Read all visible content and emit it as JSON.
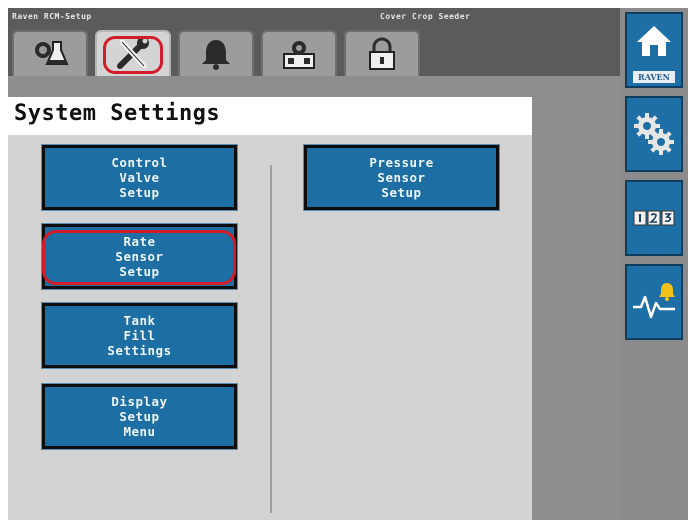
{
  "window": {
    "title_left": "Raven RCM-Setup",
    "title_right": "Cover Crop Seeder"
  },
  "tabs": [
    {
      "icon": "product-flask-icon",
      "active": false
    },
    {
      "icon": "tools-wrench-screwdriver-icon",
      "active": true
    },
    {
      "icon": "alarm-bell-icon",
      "active": false
    },
    {
      "icon": "machine-gear-icon",
      "active": false
    },
    {
      "icon": "lock-icon",
      "active": false
    }
  ],
  "page": {
    "title": "System Settings"
  },
  "buttons": {
    "control_valve": [
      "Control",
      "Valve",
      "Setup"
    ],
    "pressure_sensor": [
      "Pressure",
      "Sensor",
      "Setup"
    ],
    "rate_sensor": [
      "Rate",
      "Sensor",
      "Setup"
    ],
    "tank_fill": [
      "Tank",
      "Fill",
      "Settings"
    ],
    "display_setup": [
      "Display",
      "Setup",
      "Menu"
    ]
  },
  "sidebar": {
    "home_brand": "RAVEN",
    "items": [
      "home-icon",
      "settings-gears-icon",
      "numeric-keypad-icon",
      "diagnostics-alarm-icon"
    ]
  },
  "colors": {
    "button_blue": "#1d6ea3",
    "highlight_red": "#d21c2a",
    "alarm_yellow": "#f2c21b"
  }
}
